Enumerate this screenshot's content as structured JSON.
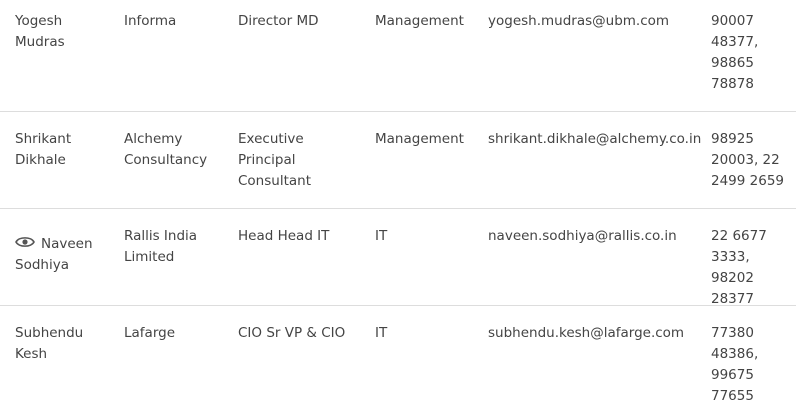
{
  "contacts": [
    {
      "name": "Yogesh Mudras",
      "company": "Informa",
      "title": "Director MD",
      "department": "Management",
      "email": "yogesh.mudras@ubm.com",
      "phone": "90007 48377, 98865 78878",
      "viewed": false
    },
    {
      "name": "Shrikant Dikhale",
      "company": "Alchemy Consultancy",
      "title": "Executive Principal Consultant",
      "department": "Management",
      "email": "shrikant.dikhale@alchemy.co.in",
      "phone": "98925 20003, 22 2499 2659",
      "viewed": false
    },
    {
      "name": "Naveen Sodhiya",
      "company": "Rallis India Limited",
      "title": "Head Head IT",
      "department": "IT",
      "email": "naveen.sodhiya@rallis.co.in",
      "phone": "22 6677 3333, 98202 28377",
      "viewed": true,
      "icon": "eye-icon"
    },
    {
      "name": "Subhendu Kesh",
      "company": "Lafarge",
      "title": "CIO Sr VP & CIO",
      "department": "IT",
      "email": "subhendu.kesh@lafarge.com",
      "phone": "77380 48386, 99675 77655",
      "viewed": false
    }
  ],
  "colors": {
    "text": "#444444",
    "divider": "#dddddd",
    "background": "#ffffff"
  }
}
